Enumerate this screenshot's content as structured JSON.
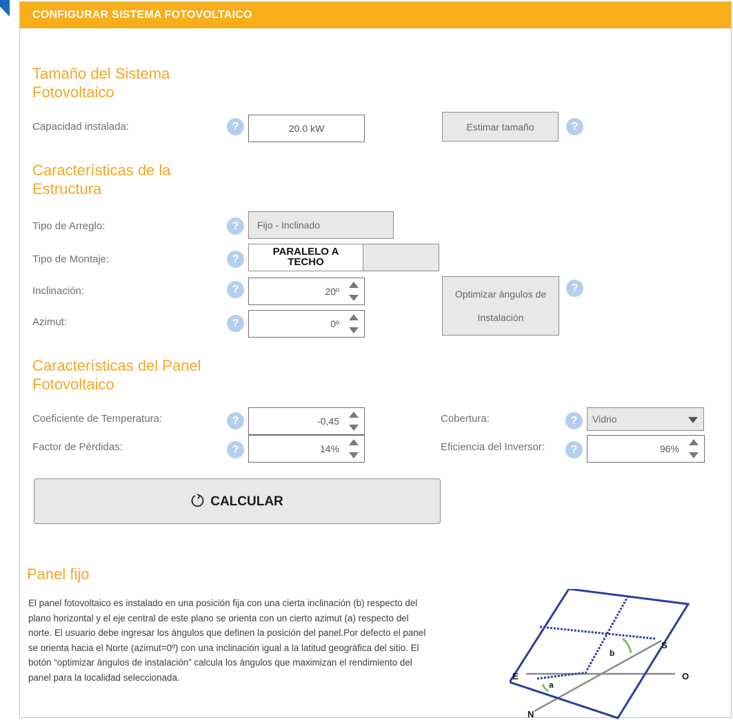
{
  "header": {
    "title": "CONFIGURAR SISTEMA FOTOVOLTAICO"
  },
  "sections": {
    "size": {
      "title_line1": "Tamaño del Sistema",
      "title_line2": "Fotovoltaico"
    },
    "structure": {
      "title_line1": "Características de la",
      "title_line2": "Estructura"
    },
    "panel": {
      "title_line1": "Características del Panel",
      "title_line2": "Fotovoltaico"
    }
  },
  "fields": {
    "capacity": {
      "label": "Capacidad instalada:",
      "value": "20.0 kW"
    },
    "estimate_button": "Estimar tamaño",
    "array_type": {
      "label": "Tipo de Arreglo:",
      "value": "Fijo - Inclinado"
    },
    "mount_type": {
      "label": "Tipo de Montaje:",
      "option_line1": "PARALELO A",
      "option_line2": "TECHO"
    },
    "tilt": {
      "label": "Inclinación:",
      "value": "20º"
    },
    "azimuth": {
      "label": "Azimut:",
      "value": "0º"
    },
    "optimize_button": {
      "line1": "Optimizar ángulos de",
      "line2": "Instalación"
    },
    "temp_coef": {
      "label": "Coeficiente de Temperatura:",
      "value": "-0,45"
    },
    "loss_factor": {
      "label": "Factor de Pérdidas:",
      "value": "14%"
    },
    "cover": {
      "label": "Cobertura:",
      "value": "Vidrio"
    },
    "inverter_eff": {
      "label": "Eficiencia del Inversor:",
      "value": "96%"
    }
  },
  "help_glyph": "?",
  "calculate_button": "CALCULAR",
  "info": {
    "title": "Panel fijo",
    "line1": "El panel fotovoltaico es instalado en una posición fija con una cierta inclinación (b) respecto del",
    "line2": "plano horizontal y el eje central de este plano se orienta con un cierto azimut (a) respecto del",
    "line3": "norte. El usuario debe ingresar los ángulos que definen la posición del panel.Por defecto el panel",
    "line4": "se orienta hacia el Norte (azimut=0º) con una inclinación igual a la latitud geográfica del sitio. El",
    "line5": "botón “optimizar ángulos de instalación” calcula los ángulos que maximizan el rendimiento del",
    "line6": "panel para la localidad seleccionada."
  },
  "diagram": {
    "label_e": "E",
    "label_o": "O",
    "label_n": "N",
    "label_s": "S",
    "label_a": "a",
    "label_b": "b"
  },
  "colors": {
    "accent": "#f8ad1a",
    "section_title": "#f5a623",
    "help": "#b4cfee",
    "diagram_blue": "#2b3f9c",
    "angle_green": "#7dc15b"
  }
}
